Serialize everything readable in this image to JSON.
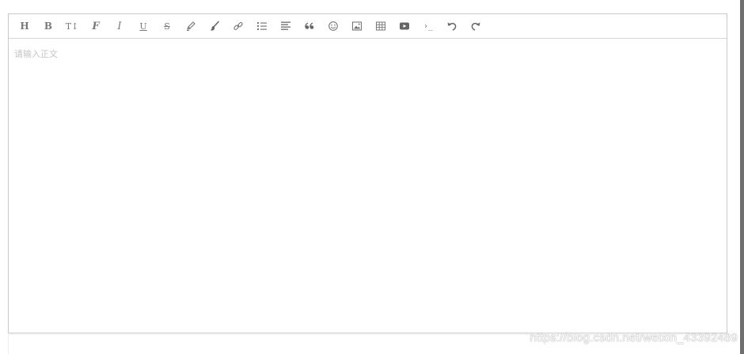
{
  "toolbar": {
    "heading": "H",
    "bold": "B",
    "font_size": "T↕",
    "font_family": "F",
    "italic": "I",
    "underline": "U",
    "strikethrough": "S",
    "quote": "“",
    "code": "›_",
    "icons": [
      "heading-icon",
      "bold-icon",
      "font-size-icon",
      "font-family-icon",
      "italic-icon",
      "underline-icon",
      "strikethrough-icon",
      "text-color-icon",
      "background-color-icon",
      "link-icon",
      "list-icon",
      "align-icon",
      "quote-icon",
      "emoticon-icon",
      "image-icon",
      "table-icon",
      "video-icon",
      "code-icon",
      "undo-icon",
      "redo-icon"
    ]
  },
  "editor": {
    "placeholder": "请输入正文"
  },
  "watermark": "https://blog.csdn.net/weixin_43392489",
  "colors": {
    "border": "#c9c9c9",
    "icon": "#777777",
    "placeholder": "#c4c4c4"
  }
}
